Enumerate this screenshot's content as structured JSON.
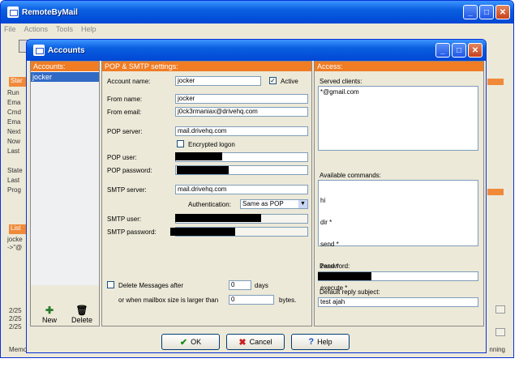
{
  "main_window": {
    "title": "RemoteByMail",
    "menu": [
      "File",
      "Actions",
      "Tools",
      "Help"
    ],
    "left_labels": [
      "Star",
      "Run",
      "Ema",
      "Cmd",
      "Ema",
      "Next",
      "Now",
      "Last",
      "State",
      "Last",
      "Prog"
    ],
    "list_header": "List",
    "list_items": [
      "jocke",
      "->\"@"
    ],
    "log_lines": [
      "2/25",
      "2/25",
      "2/25"
    ],
    "status_left": "Memo",
    "status_right": "nning"
  },
  "dialog": {
    "title": "Accounts",
    "accounts_header": "Accounts:",
    "accounts": [
      "jocker"
    ],
    "new_label": "New",
    "delete_label": "Delete",
    "settings_header": "POP & SMTP settings:",
    "account_name_label": "Account name:",
    "account_name": "jocker",
    "active_label": "Active",
    "active_checked": true,
    "from_name_label": "From name:",
    "from_name": "jocker",
    "from_email_label": "From email:",
    "from_email": "j0ck3rmaniax@drivehq.com",
    "pop_server_label": "POP server:",
    "pop_server": "mail.drivehq.com",
    "encrypted_label": "Encrypted logon",
    "encrypted_checked": false,
    "pop_user_label": "POP user:",
    "pop_password_label": "POP password:",
    "smtp_server_label": "SMTP server:",
    "smtp_server": "mail.drivehq.com",
    "auth_label": "Authentication:",
    "auth_value": "Same as POP",
    "smtp_user_label": "SMTP user:",
    "smtp_password_label": "SMTP password:",
    "delete_msgs_label": "Delete Messages after",
    "delete_days": "0",
    "days_label": "days",
    "or_when_label": "or when mailbox size is larger than",
    "size_value": "0",
    "bytes_label": "bytes.",
    "access_header": "Access:",
    "served_clients_label": "Served clients:",
    "served_clients": "*@gmail.com",
    "available_commands_label": "Available commands:",
    "available_commands": [
      "hi",
      "dir *",
      "send *",
      "zend *",
      "execute *"
    ],
    "password_label": "Password:",
    "reply_subject_label": "Default reply subject:",
    "reply_subject": "test ajah",
    "ok_label": "OK",
    "cancel_label": "Cancel",
    "help_label": "Help"
  },
  "colors": {
    "accent_orange": "#f07c24",
    "xp_blue": "#0a5fe0",
    "selection": "#316ac5"
  }
}
